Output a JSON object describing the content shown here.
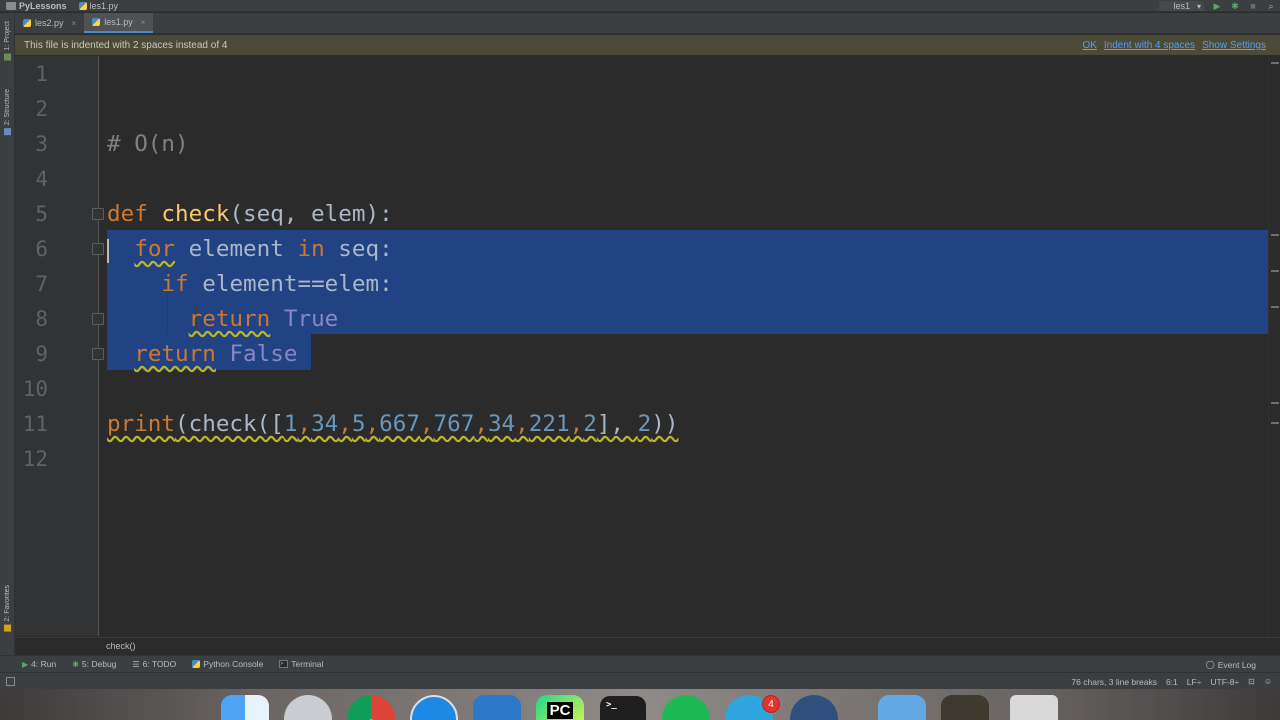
{
  "navbar": {
    "project": "PyLessons",
    "file": "les1.py",
    "run_config": "les1"
  },
  "tabs": [
    {
      "label": "les2.py",
      "active": false
    },
    {
      "label": "les1.py",
      "active": true
    }
  ],
  "left_tool_windows": {
    "project": "1: Project",
    "structure": "2: Structure",
    "favorites": "2: Favorites"
  },
  "banner": {
    "message": "This file is indented with 2 spaces instead of 4",
    "actions": {
      "ok": "OK",
      "indent": "Indent with 4 spaces",
      "settings": "Show Settings"
    }
  },
  "editor": {
    "line_numbers": [
      "1",
      "2",
      "3",
      "4",
      "5",
      "6",
      "7",
      "8",
      "9",
      "10",
      "11",
      "12"
    ],
    "code": {
      "line3_comment": "# O(n)",
      "line5": {
        "kw": "def",
        "name": "check",
        "params": "(seq, elem):"
      },
      "line6": {
        "kw_for": "for",
        "var": " element ",
        "kw_in": "in",
        "rest": " seq:"
      },
      "line7": {
        "kw": "if",
        "rest": " element==elem:"
      },
      "line8": {
        "kw": "return",
        "val": "True"
      },
      "line9": {
        "kw": "return",
        "val": "False"
      },
      "line11": {
        "print": "print",
        "open": "(check([",
        "nums": [
          "1",
          "34",
          "5",
          "667",
          "767",
          "34",
          "221",
          "2"
        ],
        "close_list": "], ",
        "arg": "2",
        "close": "))"
      }
    },
    "caret_line": 6,
    "selected_lines": [
      6,
      7,
      8,
      9
    ]
  },
  "breadcrumb": "check()",
  "tool_windows": {
    "run": "4: Run",
    "debug": "5: Debug",
    "todo": "6: TODO",
    "console": "Python Console",
    "terminal": "Terminal",
    "event_log": "Event Log"
  },
  "status": {
    "chars": "76 chars, 3 line breaks",
    "position": "6:1",
    "line_sep": "LF÷",
    "encoding": "UTF-8÷"
  },
  "dock": {
    "apps": [
      "finder",
      "launchpad",
      "chrome",
      "safari",
      "xcode",
      "pycharm",
      "terminal",
      "spotify",
      "telegram",
      "quicktime",
      "downloads-folder",
      "stack",
      "trash"
    ],
    "telegram_badge": "4",
    "pycharm_label": "PC"
  },
  "colors": {
    "keyword": "#cc7832",
    "function": "#ffc66d",
    "number": "#6897bb",
    "comment": "#808080",
    "selection": "#214283",
    "warning_squiggle": "#bbb529",
    "link": "#589df6"
  }
}
